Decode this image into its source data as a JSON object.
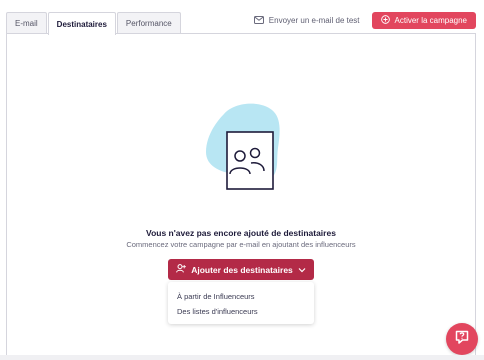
{
  "tabs": [
    {
      "label": "E-mail",
      "active": false
    },
    {
      "label": "Destinataires",
      "active": true
    },
    {
      "label": "Performance",
      "active": false
    }
  ],
  "header": {
    "test_email_label": "Envoyer un e-mail de test",
    "test_email_icon": "envelope-icon",
    "activate_label": "Activer la campagne",
    "activate_icon": "plus-circle-icon"
  },
  "empty_state": {
    "title": "Vous n'avez pas encore ajouté de destinataires",
    "subtitle": "Commencez votre campagne par e-mail en ajoutant des influenceurs",
    "illustration_icon": "contacts-frame-icon"
  },
  "add_recipients": {
    "label": "Ajouter des destinataires",
    "icon": "add-user-icon",
    "chevron_icon": "chevron-down-icon",
    "menu": [
      {
        "label": "À partir de Influenceurs"
      },
      {
        "label": "Des listes d'influenceurs"
      }
    ]
  },
  "help": {
    "icon": "chat-help-icon"
  },
  "colors": {
    "accent": "#e2465e",
    "primary_button": "#b32a47",
    "illustration_blob": "#b8e6f3",
    "text_dark": "#1e1b3a"
  }
}
